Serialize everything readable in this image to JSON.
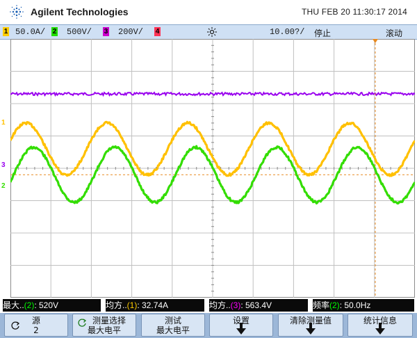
{
  "header": {
    "brand": "Agilent Technologies",
    "datetime": "THU FEB 20 11:30:17 2014"
  },
  "status": {
    "ch1": {
      "num": "1",
      "scale": "50.0A/",
      "color": "#ffcc00"
    },
    "ch2": {
      "num": "2",
      "scale": "500V/",
      "color": "#22dd00"
    },
    "ch3": {
      "num": "3",
      "scale": "200V/",
      "color": "#cc00cc"
    },
    "ch4": {
      "num": "4",
      "color": "#ff3355"
    },
    "timebase": "10.00?/",
    "run_state": "停止",
    "mode": "滚动"
  },
  "markers": {
    "ch1": "1",
    "ch3": "3",
    "ch2": "2"
  },
  "measurements": {
    "m1": {
      "label": "最大..",
      "src": "(2)",
      "value": ": 520V"
    },
    "m2": {
      "label": "均方..",
      "src": "(1)",
      "value": ": 32.74A"
    },
    "m3": {
      "label": "均方..",
      "src": "(3)",
      "value": ": 563.4V"
    },
    "m4": {
      "label": "频率",
      "src": "(2)",
      "value": ": 50.0Hz"
    }
  },
  "softkeys": [
    {
      "l1": "源",
      "l2": "2"
    },
    {
      "l1": "测量选择",
      "l2": "最大电平"
    },
    {
      "l1": "测试",
      "l2": "最大电平"
    },
    {
      "l1": "设置",
      "l2": ""
    },
    {
      "l1": "清除测量值",
      "l2": ""
    },
    {
      "l1": "统计信息",
      "l2": ""
    }
  ],
  "colors": {
    "ch1": "#ffc000",
    "ch2": "#33dd00",
    "ch3": "#9900ee",
    "trigger": "#e88a20"
  },
  "chart_data": {
    "type": "line",
    "series": [
      {
        "channel": 3,
        "shape": "flat noisy line",
        "level_div": 2.3
      },
      {
        "channel": 1,
        "shape": "sine",
        "cycles": 5,
        "amplitude_div": 0.8,
        "offset_div": 0.6
      },
      {
        "channel": 2,
        "shape": "sine",
        "cycles": 5,
        "amplitude_div": 0.85,
        "offset_div": -0.2
      }
    ],
    "grid": {
      "divisions_x": 10,
      "divisions_y": 8
    }
  }
}
